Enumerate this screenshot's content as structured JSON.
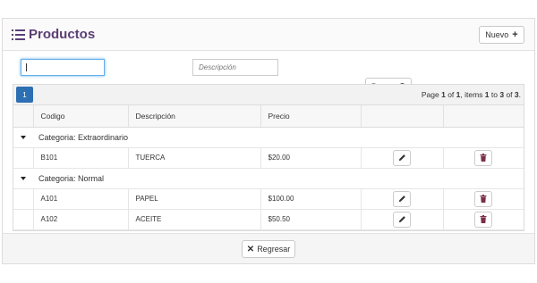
{
  "header": {
    "title": "Productos",
    "new_label": "Nuevo",
    "new_icon": "plus-icon"
  },
  "search": {
    "code_value": "",
    "desc_placeholder": "Descripción",
    "search_label": "Buscar"
  },
  "paginator": {
    "current_page": "1",
    "info_prefix": "Page ",
    "page": "1",
    "of": " of ",
    "pages": "1",
    "items_text": ", items ",
    "from": "1",
    "to": " to ",
    "to_val": "3",
    "of2": " of ",
    "total": "3",
    "end": "."
  },
  "table": {
    "columns": [
      "Codigo",
      "Descripción",
      "Precio",
      "",
      ""
    ],
    "groups": [
      {
        "label": "Categoria: Extraordinario",
        "rows": [
          {
            "codigo": "B101",
            "descripcion": "TUERCA",
            "precio": "$20.00"
          }
        ]
      },
      {
        "label": "Categoria: Normal",
        "rows": [
          {
            "codigo": "A101",
            "descripcion": "PAPEL",
            "precio": "$100.00"
          },
          {
            "codigo": "A102",
            "descripcion": "ACEITE",
            "precio": "$50.50"
          }
        ]
      }
    ]
  },
  "footer": {
    "back_label": "Regresar"
  },
  "colors": {
    "accent": "#5b3f74",
    "page_active": "#2d6fb3",
    "trash": "#7a2f4a"
  }
}
